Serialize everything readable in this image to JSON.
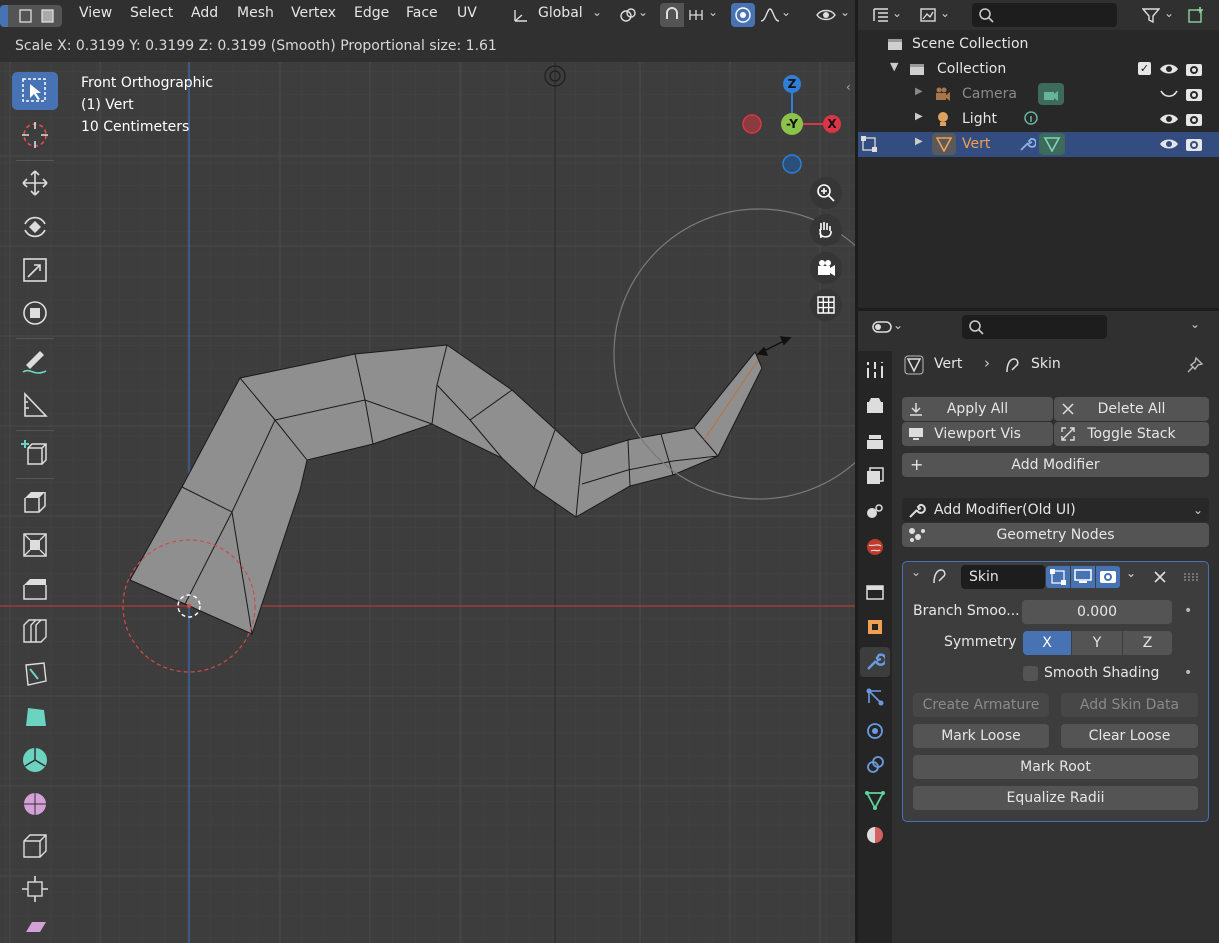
{
  "viewport": {
    "menus": [
      "View",
      "Select",
      "Add",
      "Mesh",
      "Vertex",
      "Edge",
      "Face",
      "UV"
    ],
    "orientation_label": "Global",
    "status_text": "Scale X: 0.3199   Y: 0.3199  Z: 0.3199 (Smooth) Proportional size: 1.61",
    "view_name": "Front Orthographic",
    "object_info": "(1) Vert",
    "scale_info": "10 Centimeters",
    "axes": {
      "z": "Z",
      "y": "-Y",
      "x": "X"
    },
    "colors": {
      "x_axis": "#dc3545",
      "y_axis": "#8bc34a",
      "z_axis": "#2f7fd8",
      "accent": "#4772b3"
    }
  },
  "toolbar": {
    "tools": [
      "select-box-icon",
      "cursor-icon",
      "move-icon",
      "rotate-icon",
      "scale-icon",
      "transform-icon",
      "annotate-icon",
      "measure-icon",
      "add-cube-icon",
      "extrude-icon",
      "inset-icon",
      "bevel-icon",
      "loop-cut-icon",
      "knife-icon",
      "poly-build-icon",
      "spin-icon",
      "smooth-icon",
      "edge-slide-icon",
      "shrink-fatten-icon",
      "shear-icon"
    ]
  },
  "outliner": {
    "root": "Scene Collection",
    "collection": "Collection",
    "items": [
      {
        "label": "Camera"
      },
      {
        "label": "Light"
      },
      {
        "label": "Vert"
      }
    ]
  },
  "properties": {
    "breadcrumb_object": "Vert",
    "breadcrumb_modifier": "Skin",
    "apply_all": "Apply All",
    "delete_all": "Delete All",
    "viewport_vis": "Viewport Vis",
    "toggle_stack": "Toggle Stack",
    "add_modifier": "Add Modifier",
    "add_modifier_old": "Add Modifier(Old UI)",
    "geometry_nodes": "Geometry Nodes",
    "modifier": {
      "name": "Skin",
      "branch_label": "Branch Smoo...",
      "branch_value": "0.000",
      "symmetry_label": "Symmetry",
      "sym_x": "X",
      "sym_y": "Y",
      "sym_z": "Z",
      "smooth_shading": "Smooth Shading",
      "create_armature": "Create Armature",
      "add_skin_data": "Add Skin Data",
      "mark_loose": "Mark Loose",
      "clear_loose": "Clear Loose",
      "mark_root": "Mark Root",
      "equalize_radii": "Equalize Radii"
    }
  }
}
